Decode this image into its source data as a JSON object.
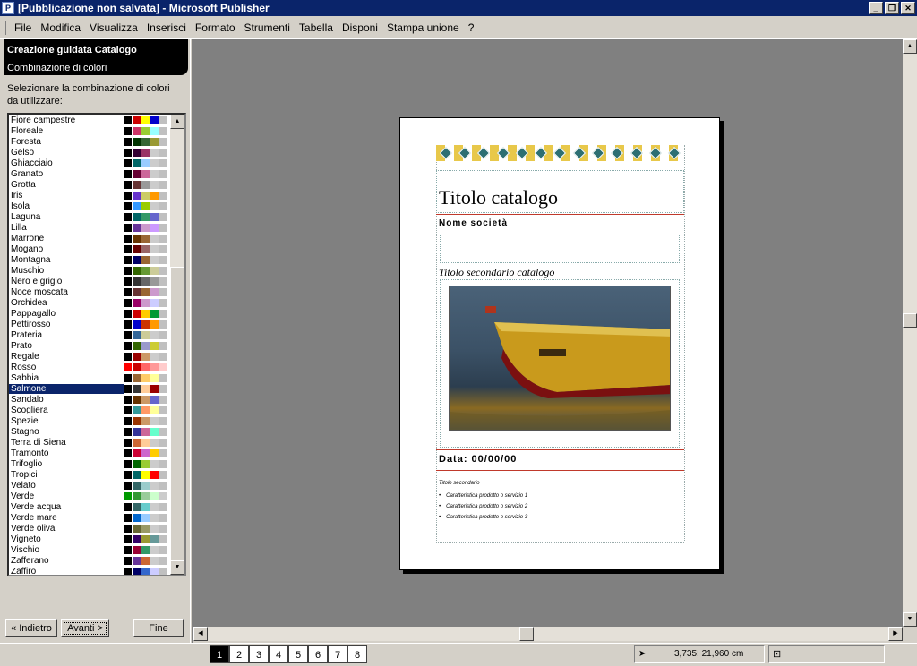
{
  "window": {
    "title": "[Pubblicazione non salvata] - Microsoft Publisher",
    "app_icon": "P"
  },
  "menu": [
    "File",
    "Modifica",
    "Visualizza",
    "Inserisci",
    "Formato",
    "Strumenti",
    "Tabella",
    "Disponi",
    "Stampa unione",
    "?"
  ],
  "wizard": {
    "title": "Creazione guidata Catalogo",
    "step": "Combinazione di colori",
    "prompt": "Selezionare la combinazione di colori da utilizzare:",
    "selected": "Salmone",
    "schemes": [
      {
        "name": "Fiore campestre",
        "colors": [
          "#000000",
          "#cc0000",
          "#ffff00",
          "#0000cc",
          "#c0c0c0"
        ]
      },
      {
        "name": "Floreale",
        "colors": [
          "#000000",
          "#cc3366",
          "#99cc33",
          "#99ffff",
          "#c0c0c0"
        ]
      },
      {
        "name": "Foresta",
        "colors": [
          "#000000",
          "#003300",
          "#336633",
          "#999933",
          "#c0c0c0"
        ]
      },
      {
        "name": "Gelso",
        "colors": [
          "#000000",
          "#330033",
          "#993366",
          "#cccccc",
          "#c0c0c0"
        ]
      },
      {
        "name": "Ghiacciaio",
        "colors": [
          "#000000",
          "#006666",
          "#99ccff",
          "#cccccc",
          "#c0c0c0"
        ]
      },
      {
        "name": "Granato",
        "colors": [
          "#000000",
          "#660033",
          "#cc6699",
          "#cccccc",
          "#c0c0c0"
        ]
      },
      {
        "name": "Grotta",
        "colors": [
          "#000000",
          "#663333",
          "#999999",
          "#cccccc",
          "#c0c0c0"
        ]
      },
      {
        "name": "Iris",
        "colors": [
          "#000000",
          "#6633cc",
          "#cccc66",
          "#ff9900",
          "#c0c0c0"
        ]
      },
      {
        "name": "Isola",
        "colors": [
          "#000000",
          "#3399ff",
          "#99cc00",
          "#cccccc",
          "#c0c0c0"
        ]
      },
      {
        "name": "Laguna",
        "colors": [
          "#000000",
          "#006666",
          "#339966",
          "#6666cc",
          "#c0c0c0"
        ]
      },
      {
        "name": "Lilla",
        "colors": [
          "#000000",
          "#663399",
          "#cc99cc",
          "#cc99ff",
          "#c0c0c0"
        ]
      },
      {
        "name": "Marrone",
        "colors": [
          "#000000",
          "#663300",
          "#996633",
          "#cccccc",
          "#c0c0c0"
        ]
      },
      {
        "name": "Mogano",
        "colors": [
          "#000000",
          "#660000",
          "#996666",
          "#cccccc",
          "#c0c0c0"
        ]
      },
      {
        "name": "Montagna",
        "colors": [
          "#000000",
          "#000066",
          "#996633",
          "#cccccc",
          "#c0c0c0"
        ]
      },
      {
        "name": "Muschio",
        "colors": [
          "#000000",
          "#336600",
          "#669933",
          "#cccc99",
          "#c0c0c0"
        ]
      },
      {
        "name": "Nero e grigio",
        "colors": [
          "#000000",
          "#333333",
          "#666666",
          "#999999",
          "#c0c0c0"
        ]
      },
      {
        "name": "Noce moscata",
        "colors": [
          "#000000",
          "#663333",
          "#996633",
          "#cc99cc",
          "#c0c0c0"
        ]
      },
      {
        "name": "Orchidea",
        "colors": [
          "#000000",
          "#990066",
          "#cc99cc",
          "#ccccff",
          "#c0c0c0"
        ]
      },
      {
        "name": "Pappagallo",
        "colors": [
          "#000000",
          "#cc0000",
          "#ffcc00",
          "#009933",
          "#c0c0c0"
        ]
      },
      {
        "name": "Pettirosso",
        "colors": [
          "#000000",
          "#0000cc",
          "#cc3300",
          "#ff9900",
          "#c0c0c0"
        ]
      },
      {
        "name": "Prateria",
        "colors": [
          "#000000",
          "#336699",
          "#cccc99",
          "#cccccc",
          "#c0c0c0"
        ]
      },
      {
        "name": "Prato",
        "colors": [
          "#000000",
          "#336600",
          "#9999cc",
          "#cccc33",
          "#c0c0c0"
        ]
      },
      {
        "name": "Regale",
        "colors": [
          "#000000",
          "#990000",
          "#cc9966",
          "#cccccc",
          "#c0c0c0"
        ]
      },
      {
        "name": "Rosso",
        "colors": [
          "#ff0000",
          "#cc0000",
          "#ff6666",
          "#ff9999",
          "#ffcccc"
        ]
      },
      {
        "name": "Sabbia",
        "colors": [
          "#000000",
          "#996633",
          "#ffcc66",
          "#ffff99",
          "#c0c0c0"
        ]
      },
      {
        "name": "Salmone",
        "colors": [
          "#000000",
          "#333333",
          "#ffcc99",
          "#990000",
          "#c0c0c0"
        ]
      },
      {
        "name": "Sandalo",
        "colors": [
          "#000000",
          "#663300",
          "#cc9966",
          "#6666cc",
          "#c0c0c0"
        ]
      },
      {
        "name": "Scogliera",
        "colors": [
          "#000000",
          "#339999",
          "#ff9966",
          "#ffff99",
          "#c0c0c0"
        ]
      },
      {
        "name": "Spezie",
        "colors": [
          "#000000",
          "#993300",
          "#cc9966",
          "#cccccc",
          "#c0c0c0"
        ]
      },
      {
        "name": "Stagno",
        "colors": [
          "#000000",
          "#333399",
          "#cc6699",
          "#66ffcc",
          "#c0c0c0"
        ]
      },
      {
        "name": "Terra di Siena",
        "colors": [
          "#000000",
          "#cc6633",
          "#ffcc99",
          "#cccccc",
          "#c0c0c0"
        ]
      },
      {
        "name": "Tramonto",
        "colors": [
          "#000000",
          "#cc0033",
          "#cc66cc",
          "#ffcc00",
          "#c0c0c0"
        ]
      },
      {
        "name": "Trifoglio",
        "colors": [
          "#000000",
          "#006600",
          "#99cc33",
          "#cccccc",
          "#c0c0c0"
        ]
      },
      {
        "name": "Tropici",
        "colors": [
          "#000000",
          "#006666",
          "#ffff00",
          "#ff0000",
          "#c0c0c0"
        ]
      },
      {
        "name": "Velato",
        "colors": [
          "#000000",
          "#336666",
          "#99cccc",
          "#cccccc",
          "#c0c0c0"
        ]
      },
      {
        "name": "Verde",
        "colors": [
          "#009900",
          "#339933",
          "#99cc99",
          "#ccffcc",
          "#cccccc"
        ]
      },
      {
        "name": "Verde acqua",
        "colors": [
          "#000000",
          "#336666",
          "#66cccc",
          "#cccccc",
          "#c0c0c0"
        ]
      },
      {
        "name": "Verde mare",
        "colors": [
          "#000000",
          "#0066cc",
          "#99ccff",
          "#cccccc",
          "#c0c0c0"
        ]
      },
      {
        "name": "Verde oliva",
        "colors": [
          "#000000",
          "#666633",
          "#999966",
          "#cccccc",
          "#c0c0c0"
        ]
      },
      {
        "name": "Vigneto",
        "colors": [
          "#000000",
          "#330066",
          "#999933",
          "#669999",
          "#c0c0c0"
        ]
      },
      {
        "name": "Vischio",
        "colors": [
          "#000000",
          "#990033",
          "#339966",
          "#cccccc",
          "#c0c0c0"
        ]
      },
      {
        "name": "Zafferano",
        "colors": [
          "#000000",
          "#663399",
          "#cc6633",
          "#cccccc",
          "#c0c0c0"
        ]
      },
      {
        "name": "Zaffiro",
        "colors": [
          "#000000",
          "#000066",
          "#3366cc",
          "#ccccff",
          "#c0c0c0"
        ]
      }
    ],
    "buttons": {
      "back": "« Indietro",
      "next": "Avanti >",
      "finish": "Fine"
    }
  },
  "page": {
    "catalog_title": "Titolo catalogo",
    "company": "Nome società",
    "subtitle": "Titolo secondario catalogo",
    "date": "Data: 00/00/00",
    "small_title": "Titolo secondario",
    "bullets": [
      "Caratteristica prodotto o servizio 1",
      "Caratteristica prodotto o servizio 2",
      "Caratteristica prodotto o servizio 3"
    ]
  },
  "status": {
    "pages": [
      "1",
      "2",
      "3",
      "4",
      "5",
      "6",
      "7",
      "8"
    ],
    "active_page": "1",
    "coords": "3,735; 21,960 cm"
  },
  "colors": {
    "titlebar": "#0a246a",
    "selection": "#0a246a",
    "workspace": "#808080"
  }
}
